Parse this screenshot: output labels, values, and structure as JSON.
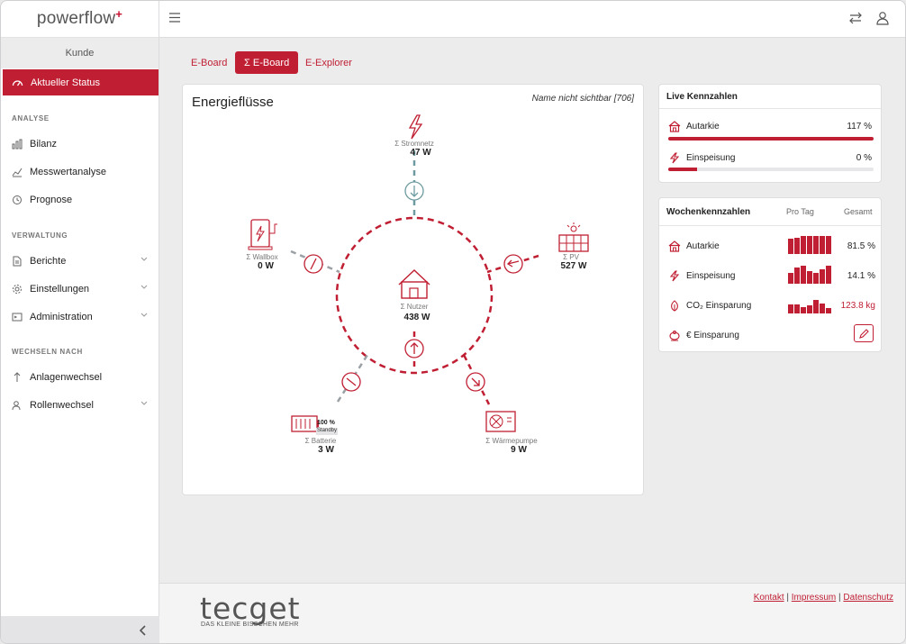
{
  "brand": {
    "name": "powerflow",
    "mark": "+"
  },
  "sidebar": {
    "customer": "Kunde",
    "active_item": "Aktueller Status",
    "sections": {
      "analyse": "ANALYSE",
      "verwaltung": "VERWALTUNG",
      "wechseln": "WECHSELN NACH"
    },
    "items": {
      "bilanz": "Bilanz",
      "messwertanalyse": "Messwertanalyse",
      "prognose": "Prognose",
      "berichte": "Berichte",
      "einstellungen": "Einstellungen",
      "administration": "Administration",
      "anlagenwechsel": "Anlagenwechsel",
      "rollenwechsel": "Rollenwechsel"
    },
    "collapse_icon": "chevron-left-icon"
  },
  "topbar": {
    "menu_icon": "hamburger-icon",
    "swap_icon": "swap-icon",
    "user_icon": "user-icon"
  },
  "tabs": [
    "E-Board",
    "Σ E-Board",
    "E-Explorer"
  ],
  "energy": {
    "title": "Energieflüsse",
    "name_note": "Name nicht sichtbar [706]",
    "nodes": {
      "grid": {
        "label": "Σ Stromnetz",
        "value": "47  W"
      },
      "pv": {
        "label": "Σ PV",
        "value": "527  W"
      },
      "wallbox": {
        "label": "Σ Wallbox",
        "value": "0  W"
      },
      "user": {
        "label": "Σ Nutzer",
        "value": "438 W"
      },
      "battery": {
        "label": "Σ Batterie",
        "value": "3  W",
        "soc": "100 %",
        "state": "Standby"
      },
      "heatpump": {
        "label": "Σ Wärmepumpe",
        "value": "9  W"
      }
    }
  },
  "live": {
    "title": "Live Kennzahlen",
    "rows": [
      {
        "label": "Autarkie",
        "value": "117 %",
        "fill": 1.0
      },
      {
        "label": "Einspeisung",
        "value": "0 %",
        "fill": 0.14
      }
    ]
  },
  "weekly": {
    "title": "Wochenkennzahlen",
    "col_per_day": "Pro Tag",
    "col_total": "Gesamt",
    "rows": [
      {
        "label": "Autarkie",
        "value": "81.5 %",
        "bars": [
          0.85,
          0.9,
          1.0,
          1.0,
          1.0,
          1.0,
          1.0
        ]
      },
      {
        "label": "Einspeisung",
        "value": "14.1 %",
        "bars": [
          0.6,
          0.9,
          1.0,
          0.7,
          0.6,
          0.8,
          1.0
        ]
      },
      {
        "label": "CO₂ Einsparung",
        "value": "123.8 kg",
        "value_color": "#c01f33",
        "bars": [
          0.5,
          0.5,
          0.35,
          0.45,
          0.75,
          0.55,
          0.3
        ]
      },
      {
        "label": "€ Einsparung",
        "value": ""
      }
    ],
    "edit_icon": "pencil-icon"
  },
  "footer": {
    "logo": "tecget",
    "tagline": "DAS KLEINE BISSCHEN MEHR",
    "links": [
      "Kontakt",
      "Impressum",
      "Datenschutz"
    ],
    "separator": "|"
  },
  "colors": {
    "accent": "#c01f33",
    "teal": "#6d9ba0",
    "gray_dash": "#9aa0a3"
  }
}
